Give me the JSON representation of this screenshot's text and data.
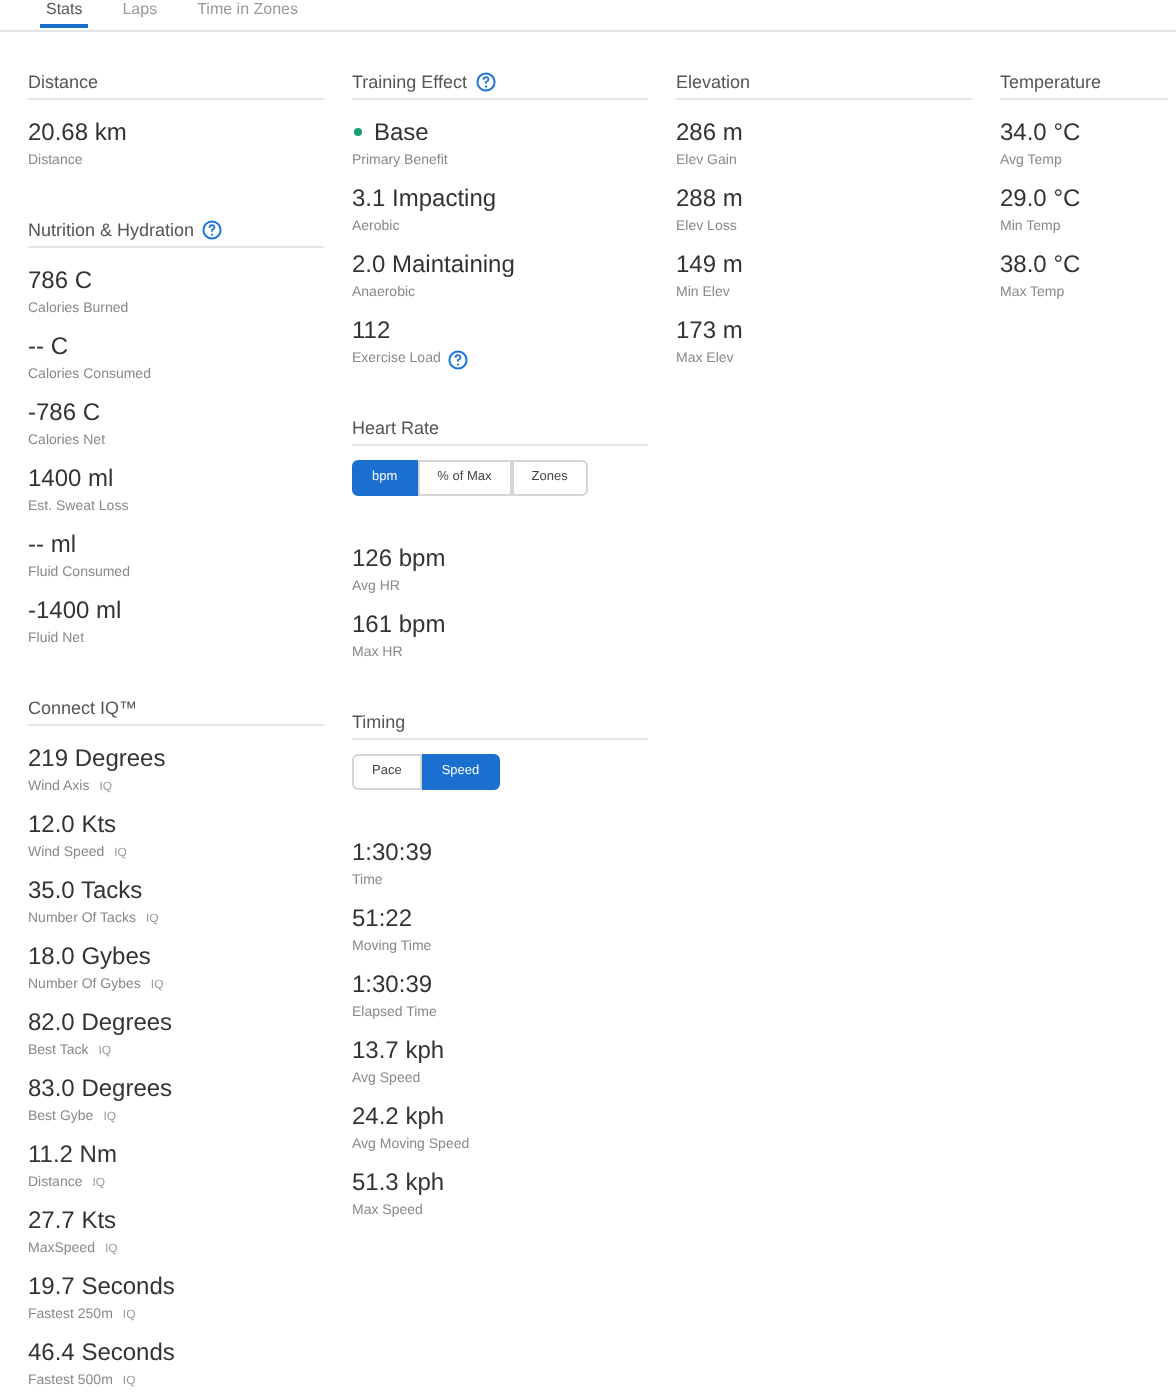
{
  "tabs": [
    {
      "label": "Stats",
      "selected": true
    },
    {
      "label": "Laps",
      "selected": false
    },
    {
      "label": "Time in Zones",
      "selected": false
    }
  ],
  "columns": [
    {
      "sections": [
        {
          "title": "Distance",
          "items": [
            {
              "value": "20.68 km",
              "label": "Distance"
            }
          ]
        },
        {
          "title": "Nutrition & Hydration",
          "help": true,
          "items": [
            {
              "value": "786 C",
              "label": "Calories Burned"
            },
            {
              "value": "-- C",
              "label": "Calories Consumed"
            },
            {
              "value": "-786 C",
              "label": "Calories Net"
            },
            {
              "value": "1400 ml",
              "label": "Est. Sweat Loss"
            },
            {
              "value": "-- ml",
              "label": "Fluid Consumed"
            },
            {
              "value": "-1400 ml",
              "label": "Fluid Net"
            }
          ]
        },
        {
          "title": "Connect IQ™",
          "items": [
            {
              "value": "219 Degrees",
              "label": "Wind Axis",
              "badge": "IQ"
            },
            {
              "value": "12.0 Kts",
              "label": "Wind Speed",
              "badge": "IQ"
            },
            {
              "value": "35.0 Tacks",
              "label": "Number Of Tacks",
              "badge": "IQ"
            },
            {
              "value": "18.0 Gybes",
              "label": "Number Of Gybes",
              "badge": "IQ"
            },
            {
              "value": "82.0 Degrees",
              "label": "Best Tack",
              "badge": "IQ"
            },
            {
              "value": "83.0 Degrees",
              "label": "Best Gybe",
              "badge": "IQ"
            },
            {
              "value": "11.2 Nm",
              "label": "Distance",
              "badge": "IQ"
            },
            {
              "value": "27.7 Kts",
              "label": "MaxSpeed",
              "badge": "IQ"
            },
            {
              "value": "19.7 Seconds",
              "label": "Fastest 250m",
              "badge": "IQ"
            },
            {
              "value": "46.4 Seconds",
              "label": "Fastest 500m",
              "badge": "IQ"
            }
          ]
        }
      ]
    },
    {
      "sections": [
        {
          "title": "Training Effect",
          "help": true,
          "items": [
            {
              "value": "Base",
              "label": "Primary Benefit",
              "color": "#1a9e6e"
            },
            {
              "value": "3.1 Impacting",
              "label": "Aerobic"
            },
            {
              "value": "2.0 Maintaining",
              "label": "Anaerobic"
            },
            {
              "value": "112",
              "label": "Exercise Load",
              "help": true
            }
          ]
        },
        {
          "title": "Heart Rate",
          "toggle": [
            {
              "label": "bpm",
              "selected": true
            },
            {
              "label": "% of Max",
              "selected": false
            },
            {
              "label": "Zones",
              "selected": false
            }
          ],
          "items": [
            {
              "value": "126 bpm",
              "label": "Avg HR"
            },
            {
              "value": "161 bpm",
              "label": "Max HR"
            }
          ]
        },
        {
          "title": "Timing",
          "toggle": [
            {
              "label": "Pace",
              "selected": false
            },
            {
              "label": "Speed",
              "selected": true
            }
          ],
          "items": [
            {
              "value": "1:30:39",
              "label": "Time"
            },
            {
              "value": "51:22",
              "label": "Moving Time"
            },
            {
              "value": "1:30:39",
              "label": "Elapsed Time"
            },
            {
              "value": "13.7 kph",
              "label": "Avg Speed"
            },
            {
              "value": "24.2 kph",
              "label": "Avg Moving Speed"
            },
            {
              "value": "51.3 kph",
              "label": "Max Speed"
            }
          ]
        }
      ]
    },
    {
      "sections": [
        {
          "title": "Elevation",
          "items": [
            {
              "value": "286 m",
              "label": "Elev Gain"
            },
            {
              "value": "288 m",
              "label": "Elev Loss"
            },
            {
              "value": "149 m",
              "label": "Min Elev"
            },
            {
              "value": "173 m",
              "label": "Max Elev"
            }
          ]
        }
      ]
    },
    {
      "sections": [
        {
          "title": "Temperature",
          "items": [
            {
              "value": "34.0 °C",
              "label": "Avg Temp"
            },
            {
              "value": "29.0 °C",
              "label": "Min Temp"
            },
            {
              "value": "38.0 °C",
              "label": "Max Temp"
            }
          ]
        }
      ]
    }
  ]
}
